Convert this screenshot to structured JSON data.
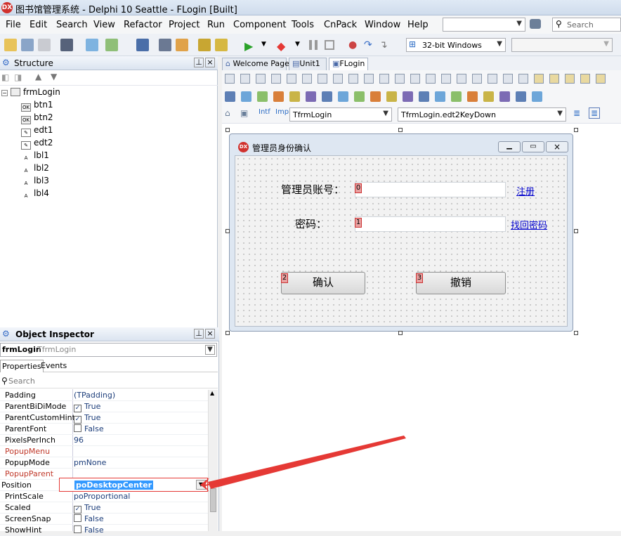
{
  "window": {
    "title": "图书馆管理系统 - Delphi 10 Seattle - FLogin [Built]",
    "logo": "DX"
  },
  "menu": [
    "File",
    "Edit",
    "Search",
    "View",
    "Refactor",
    "Project",
    "Run",
    "Component",
    "Tools",
    "CnPack",
    "Window",
    "Help"
  ],
  "search": {
    "placeholder": "Search"
  },
  "toolbar": {
    "platform": "32-bit Windows"
  },
  "structure": {
    "title": "Structure",
    "root": "frmLogin",
    "items": [
      "btn1",
      "btn2",
      "edt1",
      "edt2",
      "lbl1",
      "lbl2",
      "lbl3",
      "lbl4"
    ]
  },
  "editor": {
    "tabs": [
      "Welcome Page",
      "Unit1",
      "FLogin"
    ],
    "class_combo": "TfrmLogin",
    "method_combo": "TfrmLogin.edt2KeyDown"
  },
  "form": {
    "title": "管理员身份确认",
    "account_label": "管理员账号：",
    "password_label": "密码：",
    "register_link": "注册",
    "forgot_link": "找回密码",
    "confirm_button": "确认",
    "cancel_button": "撤销",
    "tab_orders": [
      "0",
      "1",
      "2",
      "3"
    ]
  },
  "inspector": {
    "title": "Object Inspector",
    "object_name": "frmLogin",
    "object_class": "TfrmLogin",
    "tabs": [
      "Properties",
      "Events"
    ],
    "search_placeholder": "Search",
    "properties": [
      {
        "name": "Padding",
        "value": "(TPadding)",
        "check": "",
        "red": false
      },
      {
        "name": "ParentBiDiMode",
        "value": "True",
        "check": "checked",
        "red": false
      },
      {
        "name": "ParentCustomHint",
        "value": "True",
        "check": "checked",
        "red": false
      },
      {
        "name": "ParentFont",
        "value": "False",
        "check": "unchecked",
        "red": false
      },
      {
        "name": "PixelsPerInch",
        "value": "96",
        "check": "",
        "red": false
      },
      {
        "name": "PopupMenu",
        "value": "",
        "check": "",
        "red": true
      },
      {
        "name": "PopupMode",
        "value": "pmNone",
        "check": "",
        "red": false
      },
      {
        "name": "PopupParent",
        "value": "",
        "check": "",
        "red": true
      },
      {
        "name": "Position",
        "value": "poDesktopCenter",
        "check": "",
        "red": false,
        "selected": true
      },
      {
        "name": "PrintScale",
        "value": "poProportional",
        "check": "",
        "red": false
      },
      {
        "name": "Scaled",
        "value": "True",
        "check": "checked",
        "red": false
      },
      {
        "name": "ScreenSnap",
        "value": "False",
        "check": "unchecked",
        "red": false
      },
      {
        "name": "ShowHint",
        "value": "False",
        "check": "unchecked",
        "red": false
      }
    ]
  },
  "colors": {
    "accent": "#3399ff",
    "annotation_arrow": "#e53935",
    "link": "#0000cc"
  }
}
